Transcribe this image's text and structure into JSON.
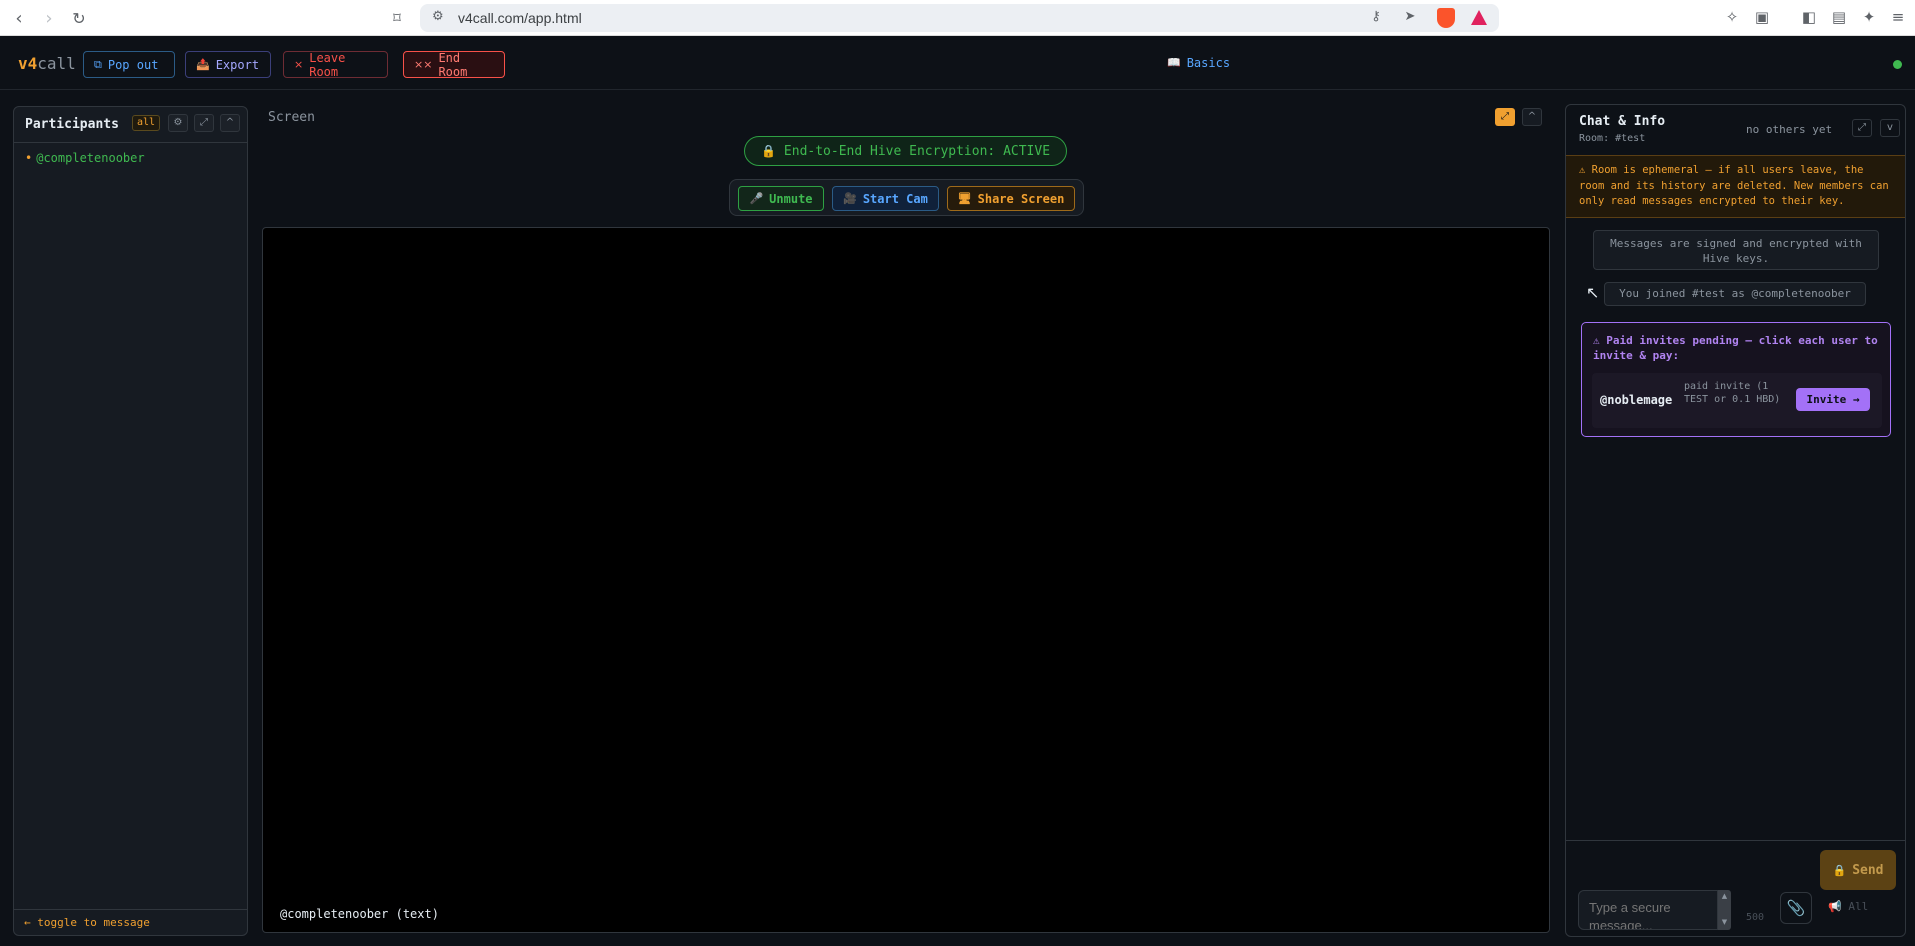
{
  "browser": {
    "url": "v4call.com/app.html"
  },
  "header": {
    "brand_strong": "v4",
    "brand_rest": "call",
    "pop_out": "Pop out",
    "export": "Export",
    "leave_room": "Leave Room",
    "end_room": "End Room",
    "basics": "Basics"
  },
  "participants": {
    "title": "Participants",
    "filter": "all",
    "users": [
      "@completenoober"
    ],
    "toggle": "← toggle to message"
  },
  "screen": {
    "label": "Screen",
    "encryption": "End-to-End Hive Encryption: ACTIVE",
    "unmute": "Unmute",
    "start_cam": "Start Cam",
    "share_screen": "Share Screen",
    "video_label": "@completenoober (text)"
  },
  "chat": {
    "title": "Chat & Info",
    "room": "Room: #test",
    "others": "no others yet",
    "warning": "⚠ Room is ephemeral — if all users leave, the room and its history are deleted. New members can only read messages encrypted to their key.",
    "system_message": "Messages are signed and encrypted with Hive keys.",
    "join_message": "You joined #test as @completenoober",
    "invite_header": "⚠ Paid invites pending — click each user to invite & pay:",
    "invite_user": "@noblemage",
    "invite_note": "paid invite (1 TEST or 0.1 HBD)",
    "invite_button": "Invite →",
    "send": "Send",
    "input_placeholder": "Type a secure message...",
    "char_count": "500",
    "all_button": "All"
  },
  "colors": {
    "accent_orange": "#f0a030",
    "accent_green": "#3fb950",
    "accent_blue": "#58a6ff",
    "accent_purple": "#a371f7",
    "danger": "#f85149"
  }
}
